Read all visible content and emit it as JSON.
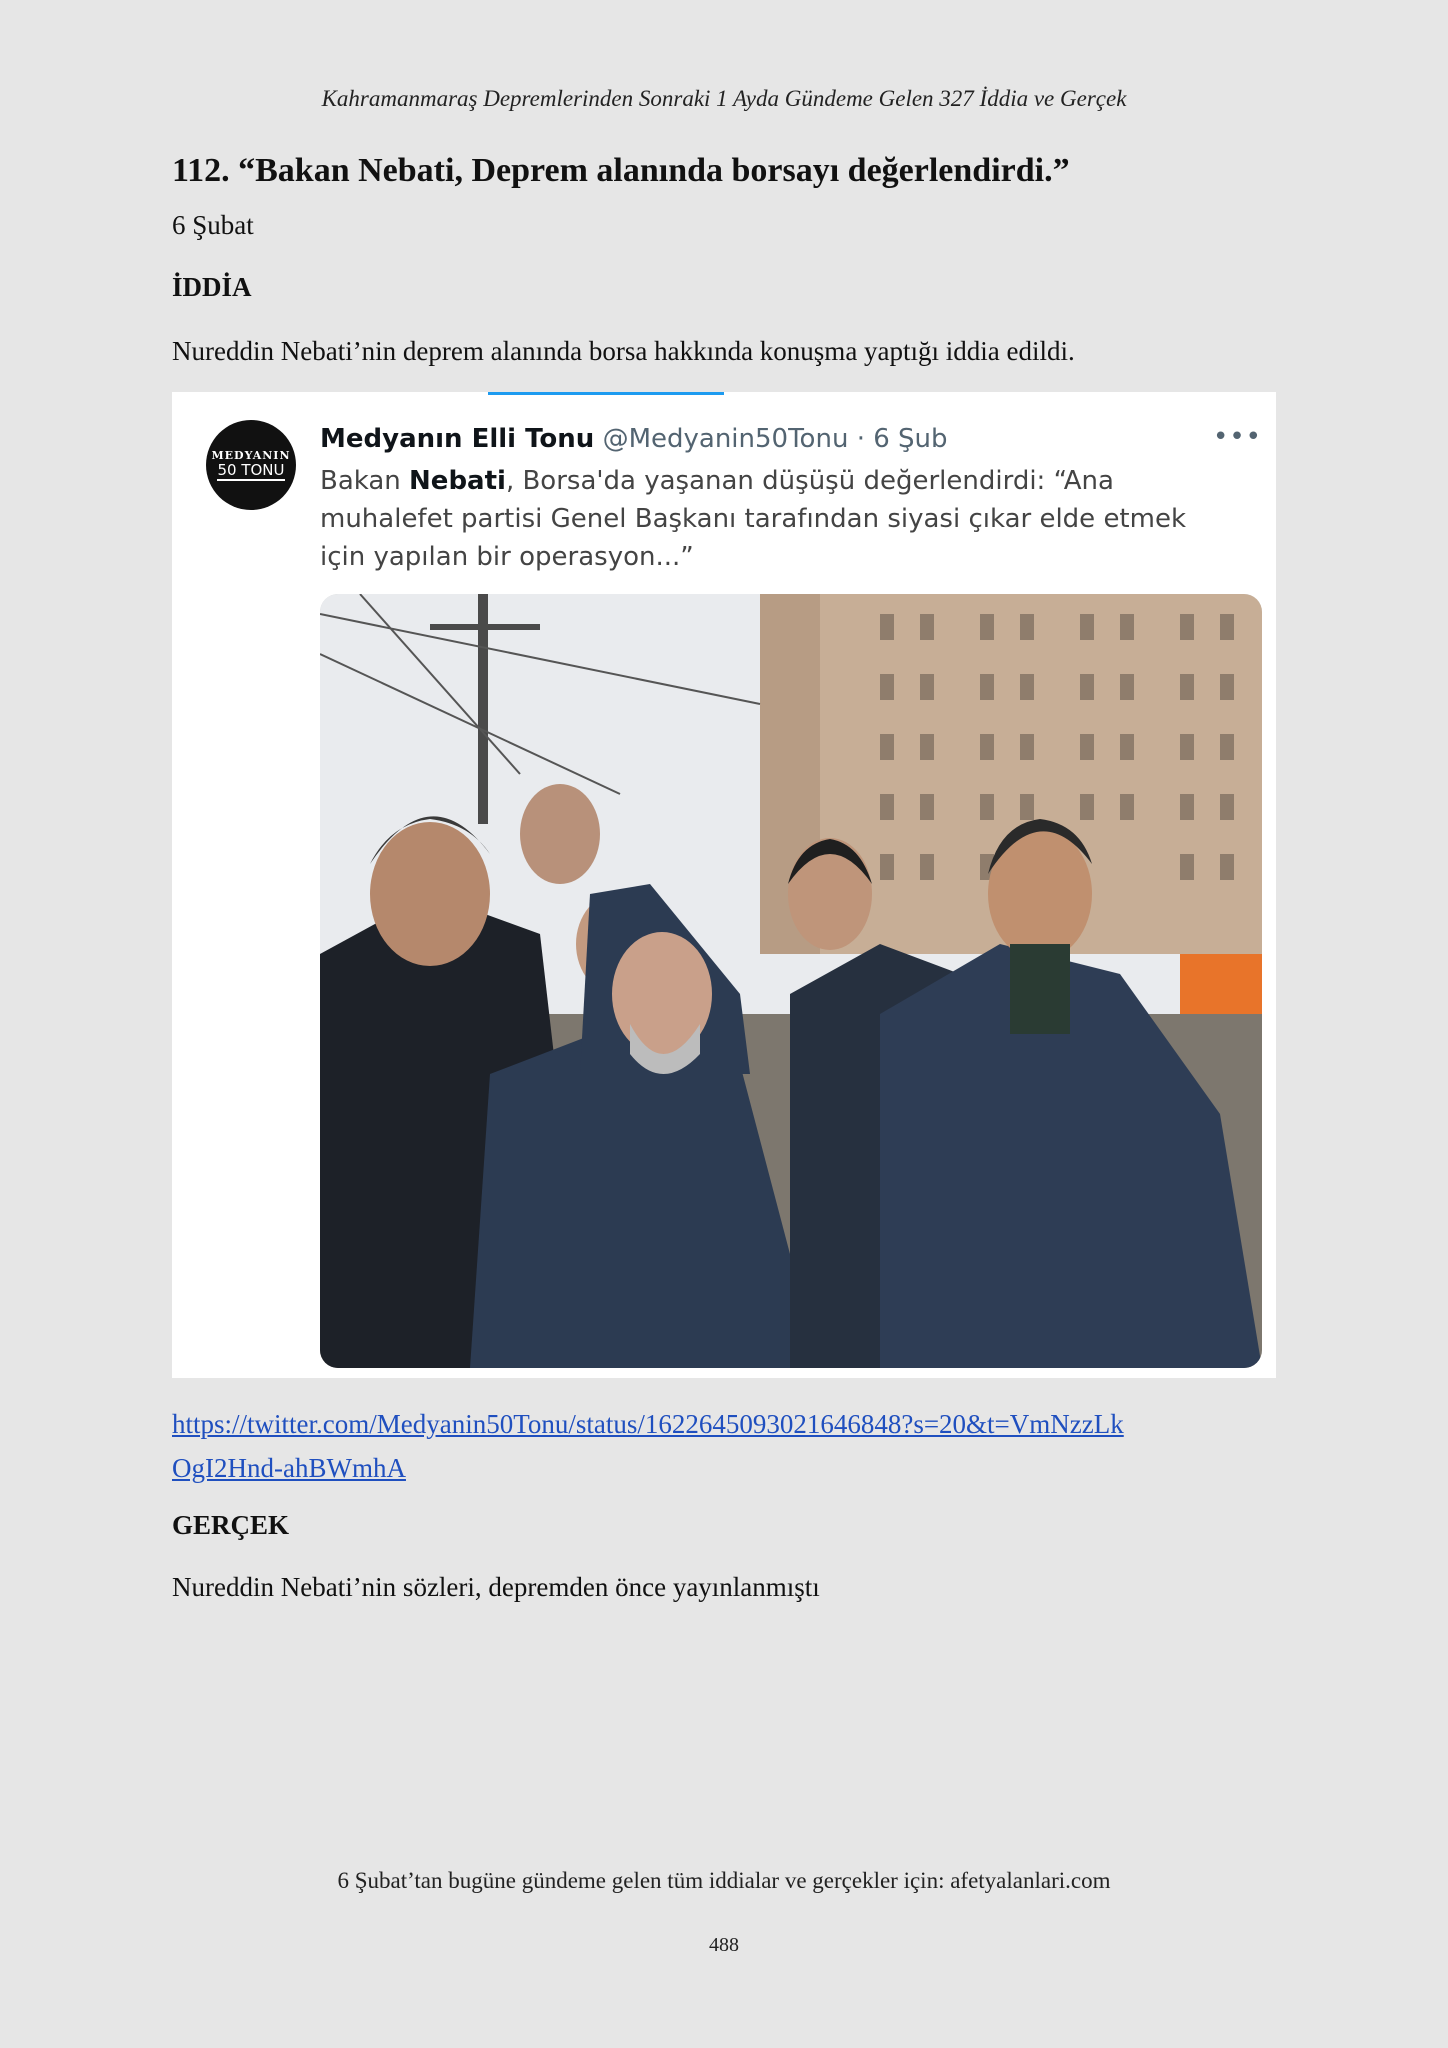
{
  "running_head": "Kahramanmaraş Depremlerinden Sonraki 1 Ayda Gündeme Gelen 327 İddia ve Gerçek",
  "article": {
    "title": "112. “Bakan Nebati, Deprem alanında borsayı değerlendirdi.”",
    "date": "6 Şubat",
    "claim_heading": "İDDİA",
    "claim_text": "Nureddin Nebati’nin deprem alanında borsa hakkında konuşma yaptığı iddia edildi.",
    "source_link_line1": "https://twitter.com/Medyanin50Tonu/status/1622645093021646848?s=20&t=VmNzzLk",
    "source_link_line2": "OgI2Hnd-ahBWmhA",
    "fact_heading": "GERÇEK",
    "fact_text": "Nureddin Nebati’nin sözleri, depremden önce yayınlanmıştı"
  },
  "tweet": {
    "avatar_line1": "MEDYANIN",
    "avatar_line2": "50 TONU",
    "name": "Medyanın Elli Tonu",
    "handle": "@Medyanin50Tonu",
    "separator": "·",
    "time": "6 Şub",
    "more": "•••",
    "text_before": "Bakan ",
    "text_bold": "Nebati",
    "text_after": ", Borsa'da yaşanan düşüşü değerlendirdi: “Ana muhalefet partisi Genel Başkanı tarafından siyasi çıkar elde etmek için yapılan bir operasyon...”"
  },
  "footer": {
    "text": "6 Şubat’tan bugüne gündeme gelen tüm iddialar ve gerçekler için: afetyalanlari.com",
    "page_number": "488"
  }
}
